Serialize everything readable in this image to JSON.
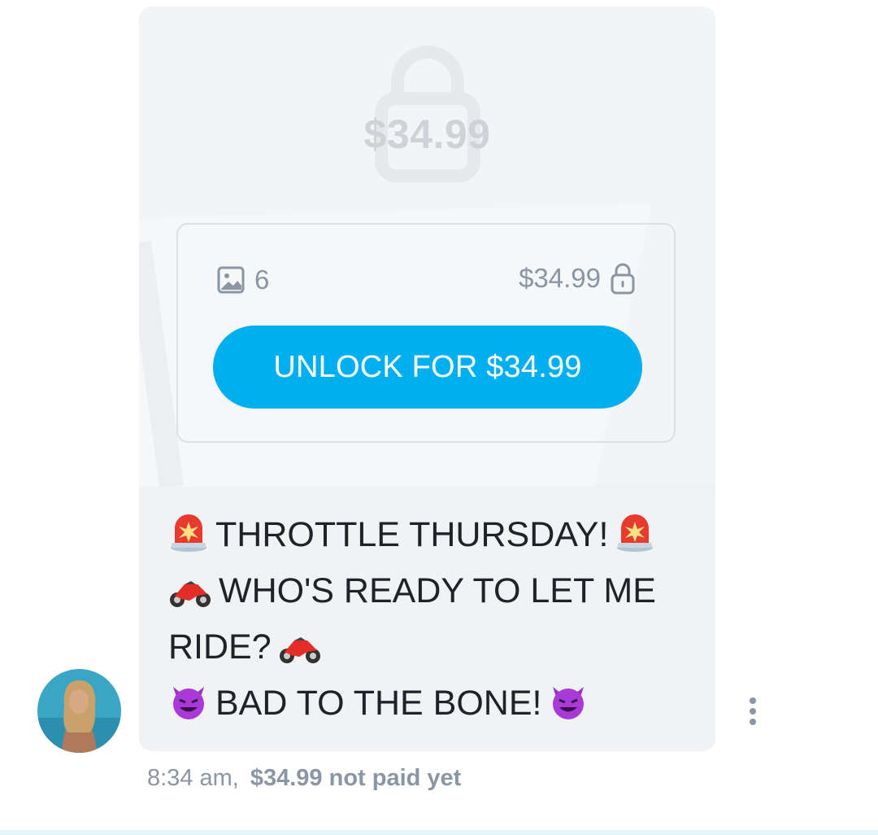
{
  "message": {
    "locked_preview": {
      "price": "$34.99",
      "media_count": "6",
      "media_icon": "image-icon",
      "card_price": "$34.99",
      "card_lock_icon": "lock-icon",
      "unlock_label": "UNLOCK FOR $34.99",
      "accent_color": "#00aff0"
    },
    "caption": {
      "line1": "THROTTLE THURSDAY!",
      "line2": "WHO'S READY TO LET ME",
      "line3": "RIDE?",
      "line4": "BAD TO THE BONE!",
      "emoji": [
        "siren-icon",
        "motorcycle-icon",
        "smiling-devil-icon"
      ]
    },
    "time": "8:34 am,",
    "price_status": "$34.99",
    "payment_status": "not paid yet"
  },
  "sender": {
    "avatar": "avatar"
  },
  "actions": {
    "more_icon": "more-vertical-icon"
  }
}
